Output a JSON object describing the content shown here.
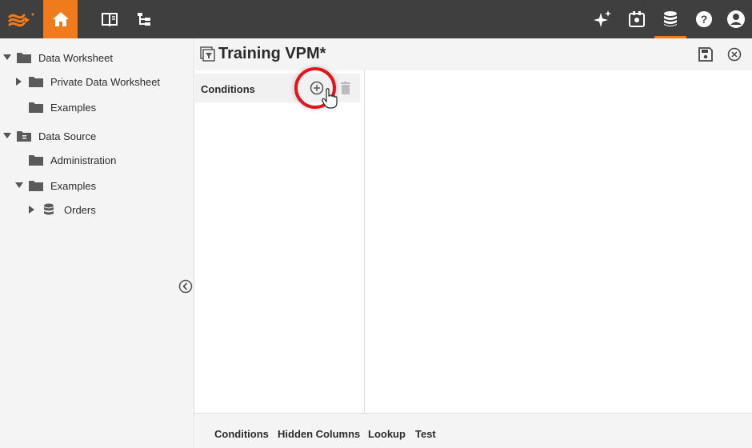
{
  "topbar": {
    "icons": [
      "logo-icon",
      "home-icon",
      "book-icon",
      "tree-structure-icon",
      "sparkle-icon",
      "portal-icon",
      "database-icon",
      "help-icon",
      "user-icon"
    ],
    "accent_color": "#f07b1d",
    "background_color": "#3f3f3f"
  },
  "sidebar": {
    "items": [
      {
        "label": "Data Worksheet",
        "icon": "folder-icon",
        "expanded": true
      },
      {
        "label": "Private Data Worksheet",
        "icon": "folder-icon",
        "expanded": false
      },
      {
        "label": "Examples",
        "icon": "folder-icon"
      },
      {
        "label": "Data Source",
        "icon": "data-source-icon",
        "expanded": true
      },
      {
        "label": "Administration",
        "icon": "folder-icon"
      },
      {
        "label": "Examples",
        "icon": "folder-icon",
        "expanded": true
      },
      {
        "label": "Orders",
        "icon": "database-icon",
        "expanded": false
      }
    ]
  },
  "editor": {
    "title": "Training VPM*",
    "conditions_label": "Conditions"
  },
  "footer": {
    "tabs": [
      "Conditions",
      "Hidden Columns",
      "Lookup",
      "Test"
    ]
  },
  "highlight_color": "#e3141b"
}
